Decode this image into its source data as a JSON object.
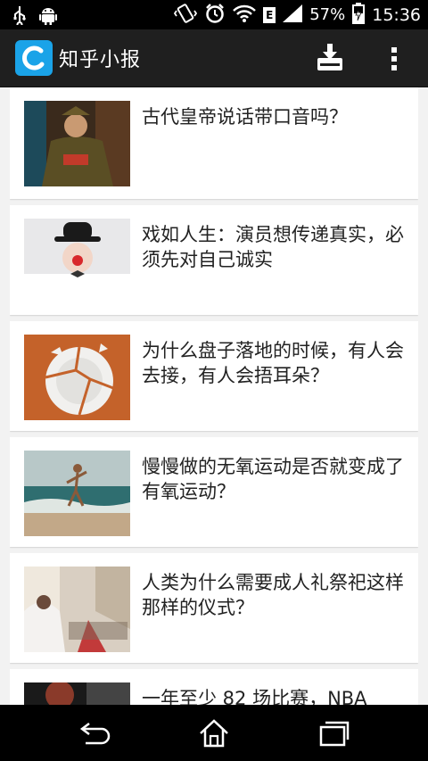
{
  "status_bar": {
    "battery_percent": "57%",
    "time": "15:36",
    "network_type": "E"
  },
  "app": {
    "title": "知乎小报",
    "logo_icon": "zhihu-daily-logo-icon",
    "accent_color": "#1aa3e8"
  },
  "toolbar": {
    "download_icon": "download-icon",
    "overflow_icon": "more-vertical-icon"
  },
  "stories": [
    {
      "title": "古代皇帝说话带口音吗？",
      "thumb": "emperor-portrait"
    },
    {
      "title": "戏如人生：演员想传递真实，必须先对自己诚实",
      "thumb": "clown-with-bowler-hat"
    },
    {
      "title": "为什么盘子落地的时候，有人会去接，有人会捂耳朵？",
      "thumb": "broken-plate"
    },
    {
      "title": "慢慢做的无氧运动是否就变成了有氧运动？",
      "thumb": "runner-on-beach"
    },
    {
      "title": "人类为什么需要成人礼祭祀这样那样的仪式？",
      "thumb": "wedding-ceremony"
    },
    {
      "title": "一年至少 82 场比赛，NBA",
      "thumb": "basketball-player"
    }
  ],
  "nav": {
    "back_icon": "back-icon",
    "home_icon": "home-icon",
    "recents_icon": "recent-apps-icon"
  }
}
